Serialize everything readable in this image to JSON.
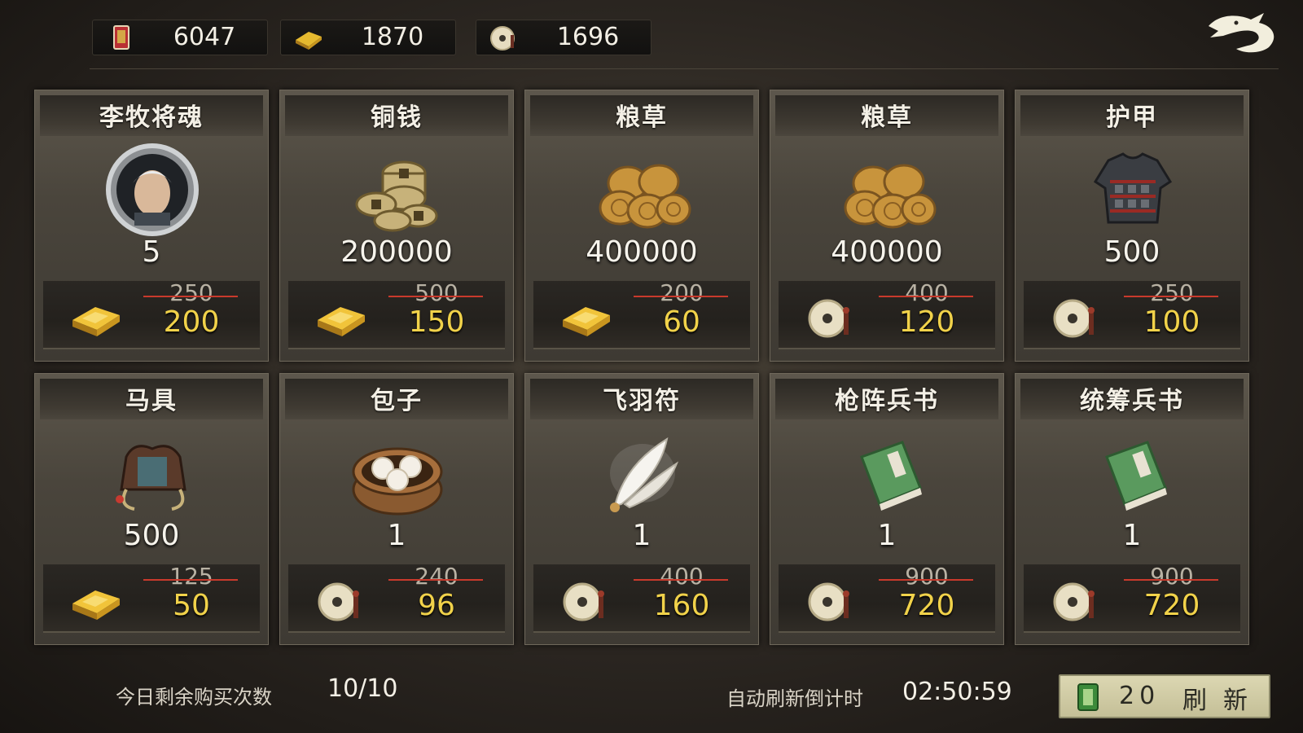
{
  "currencies": [
    {
      "icon": "token-card-icon",
      "value": "6047"
    },
    {
      "icon": "gold-ingot-icon",
      "value": "1870"
    },
    {
      "icon": "jade-coin-icon",
      "value": "1696"
    }
  ],
  "items": [
    {
      "name": "李牧将魂",
      "art": "general-portrait-icon",
      "qty": "5",
      "pay": "gold-ingot-icon",
      "old_price": "250",
      "new_price": "200"
    },
    {
      "name": "铜钱",
      "art": "copper-coins-icon",
      "qty": "200000",
      "pay": "gold-ingot-icon",
      "old_price": "500",
      "new_price": "150"
    },
    {
      "name": "粮草",
      "art": "hay-bales-icon",
      "qty": "400000",
      "pay": "gold-ingot-icon",
      "old_price": "200",
      "new_price": "60"
    },
    {
      "name": "粮草",
      "art": "hay-bales-icon",
      "qty": "400000",
      "pay": "jade-coin-icon",
      "old_price": "400",
      "new_price": "120"
    },
    {
      "name": "护甲",
      "art": "armor-icon",
      "qty": "500",
      "pay": "jade-coin-icon",
      "old_price": "250",
      "new_price": "100"
    },
    {
      "name": "马具",
      "art": "saddle-icon",
      "qty": "500",
      "pay": "gold-ingot-icon",
      "old_price": "125",
      "new_price": "50"
    },
    {
      "name": "包子",
      "art": "steamed-buns-icon",
      "qty": "1",
      "pay": "jade-coin-icon",
      "old_price": "240",
      "new_price": "96"
    },
    {
      "name": "飞羽符",
      "art": "feather-icon",
      "qty": "1",
      "pay": "jade-coin-icon",
      "old_price": "400",
      "new_price": "160"
    },
    {
      "name": "枪阵兵书",
      "art": "green-book-icon",
      "qty": "1",
      "pay": "jade-coin-icon",
      "old_price": "900",
      "new_price": "720"
    },
    {
      "name": "统筹兵书",
      "art": "green-book-icon",
      "qty": "1",
      "pay": "jade-coin-icon",
      "old_price": "900",
      "new_price": "720"
    }
  ],
  "footer": {
    "remaining_label": "今日剩余购买次数",
    "remaining_value": "10/10",
    "countdown_label": "自动刷新倒计时",
    "countdown_value": "02:50:59",
    "refresh_cost": "20",
    "refresh_label": "刷新"
  },
  "colors": {
    "price_new": "#f1d24a",
    "strike": "#c93a2c",
    "button": "#d4cfaa"
  }
}
